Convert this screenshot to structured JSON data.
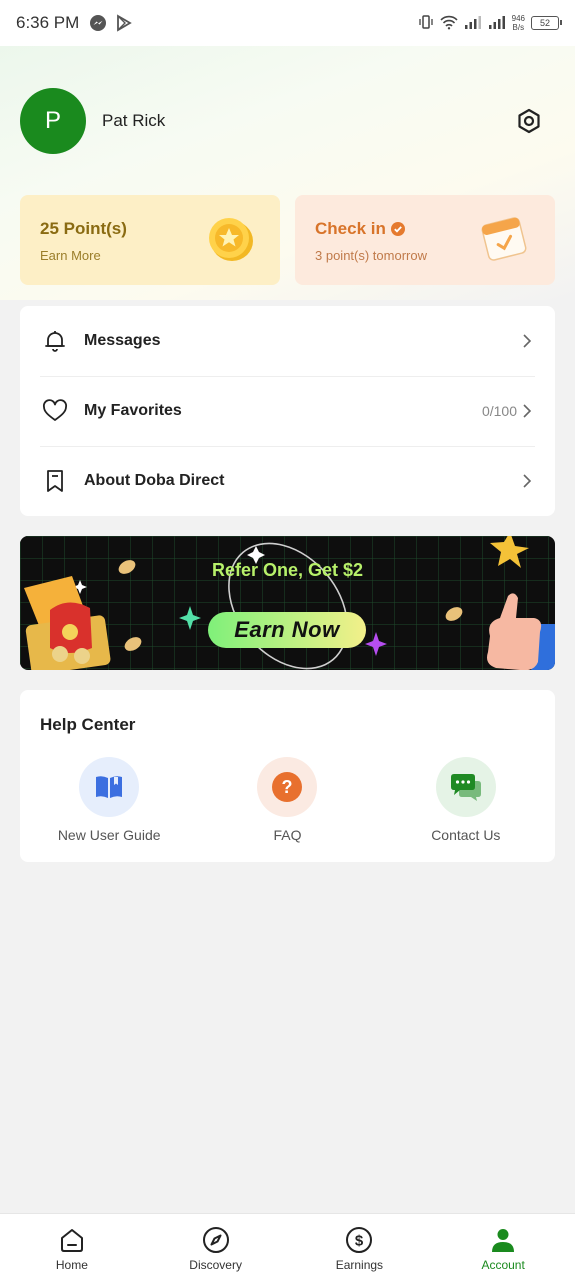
{
  "status_bar": {
    "time": "6:36 PM",
    "net_speed_value": "946",
    "net_speed_unit": "B/s",
    "battery": "52"
  },
  "profile": {
    "avatar_letter": "P",
    "name": "Pat Rick",
    "settings_icon": "settings-hexagon-icon"
  },
  "cards": {
    "points_title": "25 Point(s)",
    "points_sub": "Earn More",
    "checkin_title": "Check in",
    "checkin_sub": "3 point(s) tomorrow"
  },
  "menu": [
    {
      "label": "Messages",
      "icon": "bell-icon",
      "value": ""
    },
    {
      "label": "My Favorites",
      "icon": "heart-icon",
      "value": "0/100"
    },
    {
      "label": "About Doba Direct",
      "icon": "bookmark-icon",
      "value": ""
    }
  ],
  "banner": {
    "title": "Refer One, Get $2",
    "button": "Earn Now"
  },
  "help_center": {
    "title": "Help Center",
    "items": [
      {
        "label": "New User Guide",
        "icon": "book-icon"
      },
      {
        "label": "FAQ",
        "icon": "question-icon"
      },
      {
        "label": "Contact Us",
        "icon": "chat-icon"
      }
    ]
  },
  "tabs": [
    {
      "label": "Home",
      "icon": "home-icon",
      "active": false
    },
    {
      "label": "Discovery",
      "icon": "compass-icon",
      "active": false
    },
    {
      "label": "Earnings",
      "icon": "dollar-icon",
      "active": false
    },
    {
      "label": "Account",
      "icon": "person-icon",
      "active": true
    }
  ],
  "colors": {
    "brand_green": "#1a8a1e",
    "checkin_orange": "#d8742a",
    "points_gold": "#8a6b12"
  }
}
